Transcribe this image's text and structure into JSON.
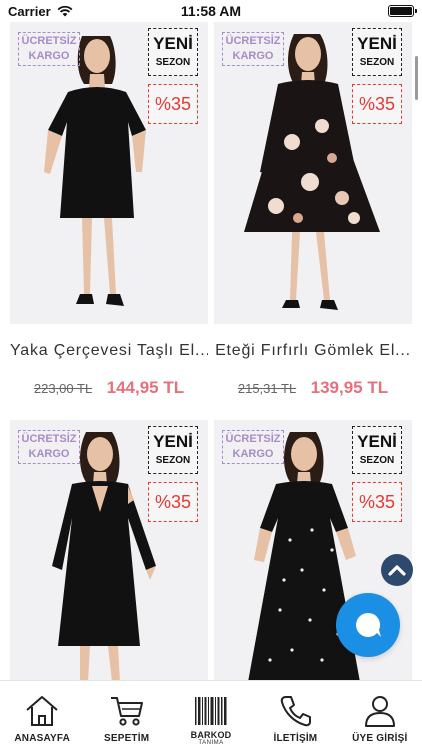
{
  "status_bar": {
    "carrier": "Carrier",
    "time": "11:58 AM"
  },
  "products": [
    {
      "badge_free": [
        "ÜCRETSİZ",
        "KARGO"
      ],
      "badge_new": [
        "YENİ",
        "SEZON"
      ],
      "discount": "%35",
      "name": "Yaka Çerçevesi Taşlı El...",
      "old_price": "223,00 TL",
      "new_price": "144,95 TL",
      "dress_color": "#111111"
    },
    {
      "badge_free": [
        "ÜCRETSİZ",
        "KARGO"
      ],
      "badge_new": [
        "YENİ",
        "SEZON"
      ],
      "discount": "%35",
      "name": "Eteği Fırfırlı Gömlek El...",
      "old_price": "215,31 TL",
      "new_price": "139,95 TL",
      "dress_color": "#1a1414"
    },
    {
      "badge_free": [
        "ÜCRETSİZ",
        "KARGO"
      ],
      "badge_new": [
        "YENİ",
        "SEZON"
      ],
      "discount": "%35",
      "dress_color": "#111111"
    },
    {
      "badge_free": [
        "ÜCRETSİZ",
        "KARGO"
      ],
      "badge_new": [
        "YENİ",
        "SEZON"
      ],
      "discount": "%35",
      "dress_color": "#121212"
    }
  ],
  "tabs": [
    {
      "label": "ANASAYFA",
      "icon": "home-icon"
    },
    {
      "label": "SEPETİM",
      "icon": "cart-icon"
    },
    {
      "label": "BARKOD",
      "sub": "TANIMA",
      "icon": "barcode-icon"
    },
    {
      "label": "İLETİŞİM",
      "icon": "phone-icon"
    },
    {
      "label": "ÜYE GİRİŞİ",
      "icon": "user-icon"
    }
  ],
  "colors": {
    "accent_purple": "#a78bca",
    "discount_red": "#e53935",
    "price_pink": "#e7707c",
    "chat_blue": "#1b8fe3",
    "scroll_top_navy": "#2d4a6e"
  }
}
